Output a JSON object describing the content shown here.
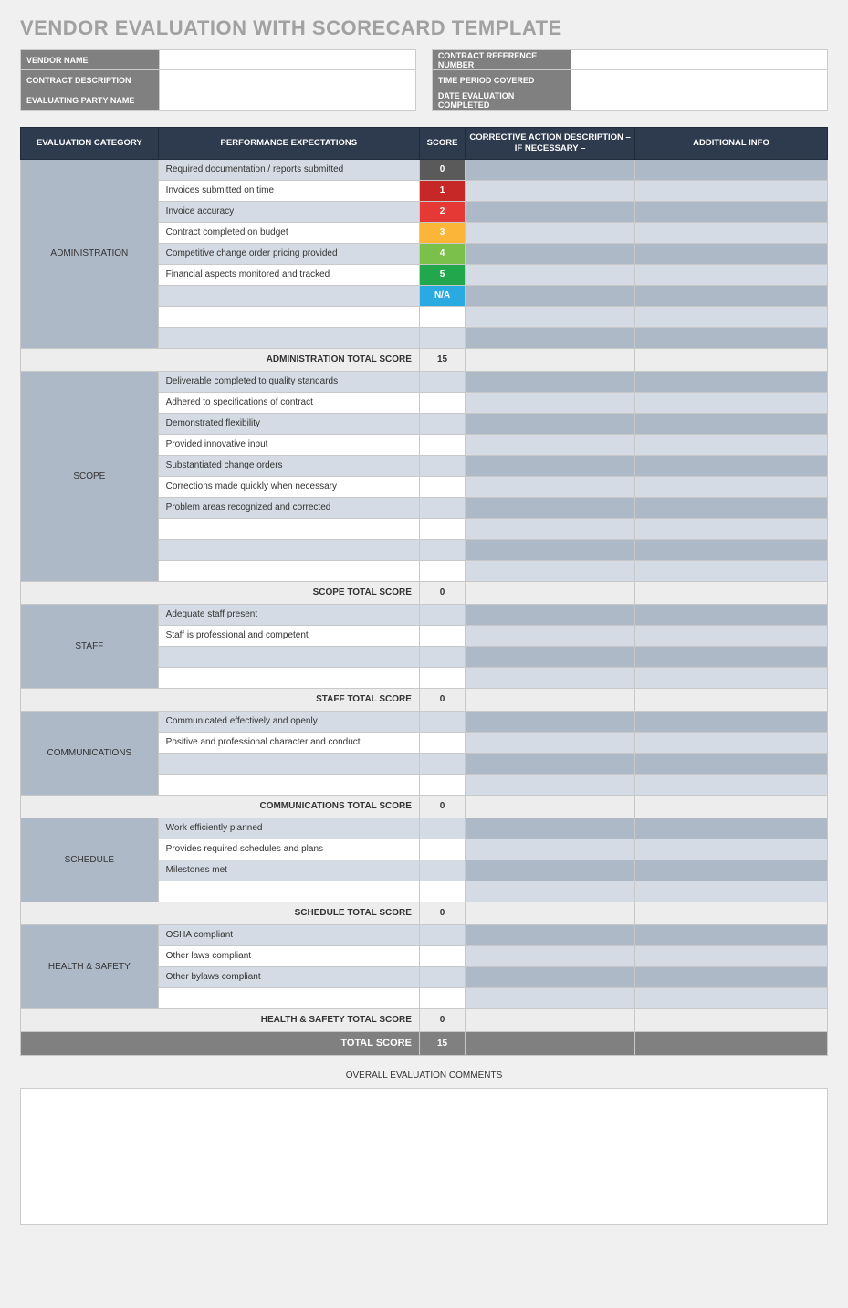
{
  "title": "VENDOR EVALUATION WITH SCORECARD TEMPLATE",
  "info_rows": [
    {
      "left_label": "VENDOR NAME",
      "left_value": "",
      "right_label": "CONTRACT REFERENCE NUMBER",
      "right_value": ""
    },
    {
      "left_label": "CONTRACT DESCRIPTION",
      "left_value": "",
      "right_label": "TIME PERIOD COVERED",
      "right_value": ""
    },
    {
      "left_label": "EVALUATING PARTY NAME",
      "left_value": "",
      "right_label": "DATE EVALUATION COMPLETED",
      "right_value": ""
    }
  ],
  "columns": {
    "category": "EVALUATION CATEGORY",
    "performance": "PERFORMANCE EXPECTATIONS",
    "score": "SCORE",
    "corrective": "CORRECTIVE ACTION DESCRIPTION – IF NECESSARY –",
    "additional": "ADDITIONAL INFO"
  },
  "score_colors": {
    "0": "#5a5a5a",
    "1": "#c62828",
    "2": "#e53935",
    "3": "#fbb63a",
    "4": "#7bc04b",
    "5": "#23a74d",
    "N/A": "#29abe2"
  },
  "categories": [
    {
      "name": "ADMINISTRATION",
      "total_label": "ADMINISTRATION TOTAL SCORE",
      "total_score": "15",
      "rows": [
        {
          "perf": "Required documentation / reports submitted",
          "score": "0",
          "corr": "",
          "addl": ""
        },
        {
          "perf": "Invoices submitted on time",
          "score": "1",
          "corr": "",
          "addl": ""
        },
        {
          "perf": "Invoice accuracy",
          "score": "2",
          "corr": "",
          "addl": ""
        },
        {
          "perf": "Contract completed on budget",
          "score": "3",
          "corr": "",
          "addl": ""
        },
        {
          "perf": "Competitive change order pricing provided",
          "score": "4",
          "corr": "",
          "addl": ""
        },
        {
          "perf": "Financial aspects monitored and tracked",
          "score": "5",
          "corr": "",
          "addl": ""
        },
        {
          "perf": "",
          "score": "N/A",
          "corr": "",
          "addl": ""
        },
        {
          "perf": "",
          "score": "",
          "corr": "",
          "addl": ""
        },
        {
          "perf": "",
          "score": "",
          "corr": "",
          "addl": ""
        }
      ]
    },
    {
      "name": "SCOPE",
      "total_label": "SCOPE TOTAL SCORE",
      "total_score": "0",
      "rows": [
        {
          "perf": "Deliverable completed to quality standards",
          "score": "",
          "corr": "",
          "addl": ""
        },
        {
          "perf": "Adhered to specifications of contract",
          "score": "",
          "corr": "",
          "addl": ""
        },
        {
          "perf": "Demonstrated flexibility",
          "score": "",
          "corr": "",
          "addl": ""
        },
        {
          "perf": "Provided innovative input",
          "score": "",
          "corr": "",
          "addl": ""
        },
        {
          "perf": "Substantiated change orders",
          "score": "",
          "corr": "",
          "addl": ""
        },
        {
          "perf": "Corrections made quickly when necessary",
          "score": "",
          "corr": "",
          "addl": ""
        },
        {
          "perf": "Problem areas recognized and corrected",
          "score": "",
          "corr": "",
          "addl": ""
        },
        {
          "perf": "",
          "score": "",
          "corr": "",
          "addl": ""
        },
        {
          "perf": "",
          "score": "",
          "corr": "",
          "addl": ""
        },
        {
          "perf": "",
          "score": "",
          "corr": "",
          "addl": ""
        }
      ]
    },
    {
      "name": "STAFF",
      "total_label": "STAFF TOTAL SCORE",
      "total_score": "0",
      "rows": [
        {
          "perf": "Adequate staff present",
          "score": "",
          "corr": "",
          "addl": ""
        },
        {
          "perf": "Staff is professional and competent",
          "score": "",
          "corr": "",
          "addl": ""
        },
        {
          "perf": "",
          "score": "",
          "corr": "",
          "addl": ""
        },
        {
          "perf": "",
          "score": "",
          "corr": "",
          "addl": ""
        }
      ]
    },
    {
      "name": "COMMUNICATIONS",
      "total_label": "COMMUNICATIONS TOTAL SCORE",
      "total_score": "0",
      "rows": [
        {
          "perf": "Communicated effectively and openly",
          "score": "",
          "corr": "",
          "addl": ""
        },
        {
          "perf": "Positive and professional character and conduct",
          "score": "",
          "corr": "",
          "addl": ""
        },
        {
          "perf": "",
          "score": "",
          "corr": "",
          "addl": ""
        },
        {
          "perf": "",
          "score": "",
          "corr": "",
          "addl": ""
        }
      ]
    },
    {
      "name": "SCHEDULE",
      "total_label": "SCHEDULE TOTAL SCORE",
      "total_score": "0",
      "rows": [
        {
          "perf": "Work efficiently planned",
          "score": "",
          "corr": "",
          "addl": ""
        },
        {
          "perf": "Provides required schedules and plans",
          "score": "",
          "corr": "",
          "addl": ""
        },
        {
          "perf": "Milestones met",
          "score": "",
          "corr": "",
          "addl": ""
        },
        {
          "perf": "",
          "score": "",
          "corr": "",
          "addl": ""
        }
      ]
    },
    {
      "name": "HEALTH & SAFETY",
      "total_label": "HEALTH & SAFETY TOTAL SCORE",
      "total_score": "0",
      "rows": [
        {
          "perf": "OSHA compliant",
          "score": "",
          "corr": "",
          "addl": ""
        },
        {
          "perf": "Other laws compliant",
          "score": "",
          "corr": "",
          "addl": ""
        },
        {
          "perf": "Other bylaws compliant",
          "score": "",
          "corr": "",
          "addl": ""
        },
        {
          "perf": "",
          "score": "",
          "corr": "",
          "addl": ""
        }
      ]
    }
  ],
  "grand_total_label": "TOTAL SCORE",
  "grand_total_score": "15",
  "comments_label": "OVERALL EVALUATION COMMENTS",
  "comments_value": ""
}
